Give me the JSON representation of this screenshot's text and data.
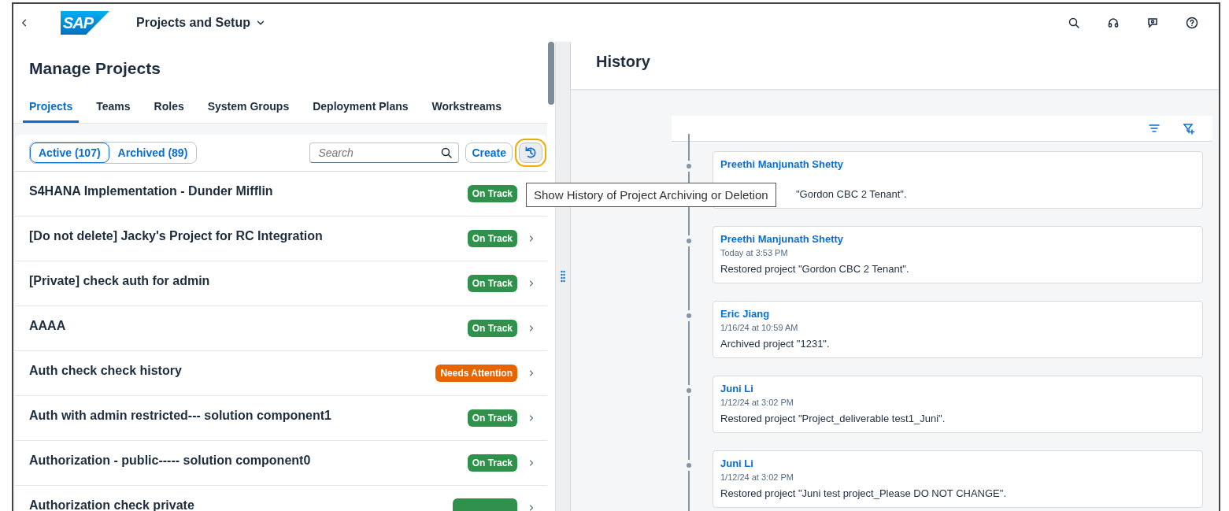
{
  "shell": {
    "logo": "SAP",
    "title": "Projects and Setup"
  },
  "page": {
    "title": "Manage Projects"
  },
  "tabs": [
    {
      "label": "Projects",
      "selected": true
    },
    {
      "label": "Teams",
      "selected": false
    },
    {
      "label": "Roles",
      "selected": false
    },
    {
      "label": "System Groups",
      "selected": false
    },
    {
      "label": "Deployment Plans",
      "selected": false
    },
    {
      "label": "Workstreams",
      "selected": false
    }
  ],
  "filter": [
    {
      "label": "Active (107)",
      "selected": true
    },
    {
      "label": "Archived (89)",
      "selected": false
    }
  ],
  "search": {
    "placeholder": "Search"
  },
  "create_button": "Create",
  "history_button": {
    "focused": true
  },
  "tooltip": "Show History of Project Archiving or Deletion",
  "projects": [
    {
      "name": "S4HANA Implementation - Dunder Mifflin",
      "status": "On Track",
      "kind": "success"
    },
    {
      "name": "[Do not delete] Jacky's Project for RC Integration",
      "status": "On Track",
      "kind": "success"
    },
    {
      "name": "[Private] check auth for admin",
      "status": "On Track",
      "kind": "success"
    },
    {
      "name": "AAAA",
      "status": "On Track",
      "kind": "success"
    },
    {
      "name": "Auth check check history",
      "status": "Needs Attention",
      "kind": "warning"
    },
    {
      "name": "Auth with admin restricted--- solution component1",
      "status": "On Track",
      "kind": "success"
    },
    {
      "name": "Authorization - public----- solution component0",
      "status": "On Track",
      "kind": "success"
    },
    {
      "name": "Authorization check private",
      "kind": "success"
    }
  ],
  "history": {
    "title": "History",
    "items": [
      {
        "user": "Preethi Manjunath Shetty",
        "text": "\"Gordon CBC 2 Tenant\".",
        "covered": true
      },
      {
        "user": "Preethi Manjunath Shetty",
        "time": "Today at 3:53 PM",
        "text": "Restored project \"Gordon CBC 2 Tenant\".",
        "covered": false
      },
      {
        "user": "Eric Jiang",
        "time": "1/16/24 at 10:59 AM",
        "text": "Archived project \"1231\".",
        "covered": false
      },
      {
        "user": "Juni Li",
        "time": "1/12/24 at 3:02 PM",
        "text": "Restored project \"Project_deliverable test1_Juni\".",
        "covered": false
      },
      {
        "user": "Juni Li",
        "time": "1/12/24 at 3:02 PM",
        "text": "Restored project \"Juni test project_Please DO NOT CHANGE\".",
        "covered": false
      }
    ]
  }
}
